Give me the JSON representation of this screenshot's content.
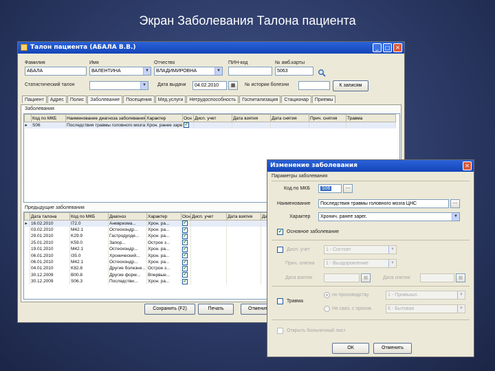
{
  "slide_title": "Экран Заболевания Талона пациента",
  "main": {
    "title": "Талон пациента (АБАЛА В.В.)",
    "labels": {
      "surname": "Фамилия",
      "name": "Имя",
      "patronymic": "Отчество",
      "pin": "ПИН-код",
      "card": "№ амб.карты",
      "stat": "Статистический талон",
      "date_issue": "Дата выдачи",
      "history": "№ истории болезни"
    },
    "values": {
      "surname": "АБАЛА",
      "name": "ВАЛЕНТИНА",
      "patronymic": "ВЛАДИМИРОВНА",
      "pin": "",
      "card": "5063",
      "stat": "",
      "date_issue": "04.02.2010",
      "history": ""
    },
    "search_button": "К записям",
    "tabs": [
      "Пациент",
      "Адрес",
      "Полис",
      "Заболевание",
      "Посещения",
      "Мед.услуги",
      "Нетрудоспособность",
      "Госпитализация",
      "Стационар",
      "Приемы"
    ],
    "section_current": "Заболевания",
    "current_headers": [
      "",
      "Код по МКБ",
      "Наименование диагноза заболевания",
      "Характер",
      "Осн",
      "Дисп. учет",
      "Дата взятия",
      "Дата снятия",
      "Прич. снятия",
      "Травма"
    ],
    "current_rows": [
      [
        "▸",
        "S06",
        "Последствия травмы головного мозга ЦНС",
        "Хрон. ранее зарег.",
        "✔",
        "",
        "",
        "",
        "",
        ""
      ]
    ],
    "section_previous": "Предыдущие заболевания",
    "prev_headers": [
      "",
      "Дата талона",
      "Код по МКБ",
      "Диагноз",
      "Характер",
      "Осн",
      "Дисп. учет",
      "Дата взятия",
      "Дата снятия"
    ],
    "prev_rows": [
      [
        "▸",
        "16.02.2010",
        "I72.0",
        "Аневризма...",
        "Хрон. ра...",
        "✔",
        "",
        "",
        ""
      ],
      [
        "",
        "03.02.2010",
        "M42.1",
        "Остеохондр...",
        "Хрон. ра...",
        "✔",
        "",
        "",
        ""
      ],
      [
        "",
        "29.01.2010",
        "K29.9",
        "Гастродуоде...",
        "Хрон. ра...",
        "✔",
        "",
        "",
        ""
      ],
      [
        "",
        "25.01.2010",
        "K59.0",
        "Запор...",
        "Острое з...",
        "✔",
        "",
        "",
        ""
      ],
      [
        "",
        "19.01.2010",
        "M42.1",
        "Остеохондр...",
        "Хрон. ра...",
        "✔",
        "",
        "",
        ""
      ],
      [
        "",
        "06.01.2010",
        "I35.0",
        "Хронический...",
        "Хрон. ра...",
        "✔",
        "",
        "",
        ""
      ],
      [
        "",
        "06.01.2010",
        "M42.1",
        "Остеохондр...",
        "Хрон. ра...",
        "✔",
        "",
        "",
        ""
      ],
      [
        "",
        "04.01.2010",
        "K82.8",
        "Другие болезни...",
        "Острое з...",
        "✔",
        "",
        "",
        ""
      ],
      [
        "",
        "30.12.2009",
        "B00.8",
        "Другие форм...",
        "Впервые...",
        "✔",
        "",
        "",
        ""
      ],
      [
        "",
        "30.12.2009",
        "S06.3",
        "Последстви...",
        "Хрон. ра...",
        "✔",
        "",
        "",
        ""
      ]
    ],
    "buttons": {
      "save": "Сохранить (F2)",
      "print": "Печать",
      "cancel": "Отменить"
    }
  },
  "dialog": {
    "title": "Изменение заболевания",
    "section": "Параметры заболевания",
    "labels": {
      "mkb": "Код по МКБ",
      "name": "Наименование",
      "character": "Характер",
      "main": "Основное заболевание",
      "disp": "Дисп. учет",
      "reason": "Прич. снятия",
      "date_taken": "Дата взятия",
      "date_removed": "Дата снятия",
      "trauma": "Травма",
      "prod": "по производству",
      "nonprod": "Не связ. с произв.",
      "open_sick": "Открыть больничный лист"
    },
    "values": {
      "mkb": "S06",
      "name": "Последствия травмы головного мозга ЦНС",
      "character": "Хронич. ранее зарег.",
      "disp": "1 - Состоит",
      "reason": "1 - Выздоровление",
      "prod_type": "1 - Промышл.",
      "nonprod_type": "6 - Бытовая"
    },
    "buttons": {
      "ok": "ОК",
      "cancel": "Отменить"
    }
  }
}
